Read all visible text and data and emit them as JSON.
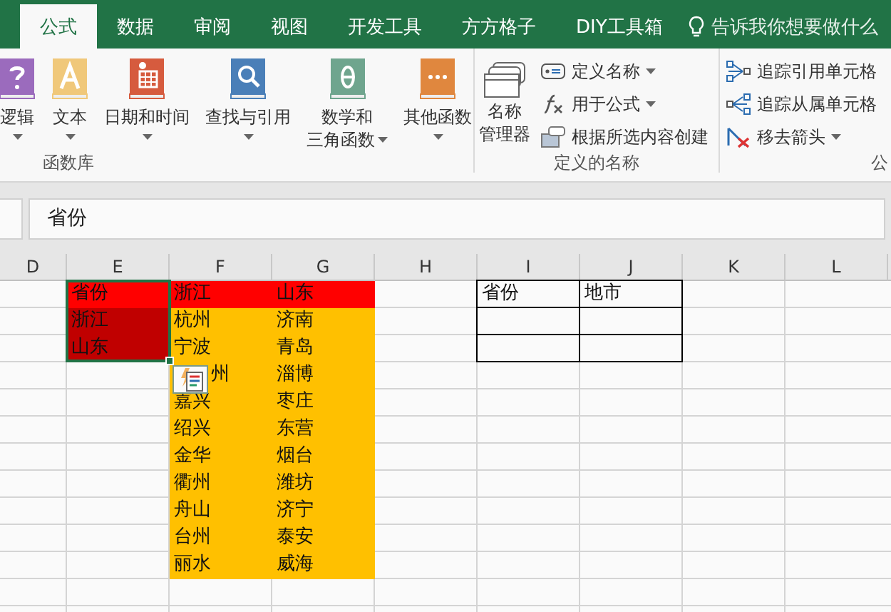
{
  "tabs": [
    {
      "label": "公式",
      "selected": true
    },
    {
      "label": "数据",
      "selected": false
    },
    {
      "label": "审阅",
      "selected": false
    },
    {
      "label": "视图",
      "selected": false
    },
    {
      "label": "开发工具",
      "selected": false
    },
    {
      "label": "方方格子",
      "selected": false
    },
    {
      "label": "DIY工具箱",
      "selected": false
    }
  ],
  "tell_me": "告诉我你想要做什么",
  "function_library": {
    "label": "函数库",
    "buttons": [
      {
        "lines": [
          "逻辑"
        ],
        "dropdown": true
      },
      {
        "lines": [
          "文本"
        ],
        "dropdown": true
      },
      {
        "lines": [
          "日期和时间"
        ],
        "dropdown": true
      },
      {
        "lines": [
          "查找与引用"
        ],
        "dropdown": true
      },
      {
        "lines": [
          "数学和",
          "三角函数"
        ],
        "dropdown": true
      },
      {
        "lines": [
          "其他函数"
        ],
        "dropdown": true
      }
    ]
  },
  "defined_names": {
    "label": "定义的名称",
    "manager": {
      "lines": [
        "名称",
        "管理器"
      ]
    },
    "items": [
      {
        "label": "定义名称",
        "dropdown": true
      },
      {
        "label": "用于公式",
        "dropdown": true
      },
      {
        "label": "根据所选内容创建",
        "dropdown": false
      }
    ]
  },
  "auditing": {
    "label": "公",
    "items": [
      {
        "label": "追踪引用单元格",
        "dropdown": false
      },
      {
        "label": "追踪从属单元格",
        "dropdown": false
      },
      {
        "label": "移去箭头",
        "dropdown": true
      }
    ]
  },
  "formula_bar": {
    "value": "省份"
  },
  "columns": [
    "D",
    "E",
    "F",
    "G",
    "H",
    "I",
    "J",
    "K",
    "L"
  ],
  "rows": [
    {
      "E": {
        "text": "省份",
        "color": "#ff0000",
        "selected": true
      },
      "F": {
        "text": "浙江",
        "color": "#ff0000"
      },
      "G": {
        "text": "山东",
        "color": "#ff0000"
      },
      "I": {
        "text": "省份",
        "bordered": true
      },
      "J": {
        "text": "地市",
        "bordered": true
      }
    },
    {
      "E": {
        "text": "浙江",
        "color": "#c00000",
        "selected": true
      },
      "F": {
        "text": "杭州",
        "color": "#ffc000"
      },
      "G": {
        "text": "济南",
        "color": "#ffc000"
      },
      "I": {
        "bordered": true
      },
      "J": {
        "bordered": true
      }
    },
    {
      "E": {
        "text": "山东",
        "color": "#c00000",
        "selected": true
      },
      "F": {
        "text": "宁波",
        "color": "#ffc000"
      },
      "G": {
        "text": "青岛",
        "color": "#ffc000"
      },
      "I": {
        "bordered": true
      },
      "J": {
        "bordered": true
      }
    },
    {
      "F": {
        "text": "州",
        "color": "#ffc000",
        "covered": true
      },
      "G": {
        "text": "淄博",
        "color": "#ffc000"
      }
    },
    {
      "F": {
        "text": "嘉兴",
        "color": "#ffc000"
      },
      "G": {
        "text": "枣庄",
        "color": "#ffc000"
      }
    },
    {
      "F": {
        "text": "绍兴",
        "color": "#ffc000"
      },
      "G": {
        "text": "东营",
        "color": "#ffc000"
      }
    },
    {
      "F": {
        "text": "金华",
        "color": "#ffc000"
      },
      "G": {
        "text": "烟台",
        "color": "#ffc000"
      }
    },
    {
      "F": {
        "text": "衢州",
        "color": "#ffc000"
      },
      "G": {
        "text": "潍坊",
        "color": "#ffc000"
      }
    },
    {
      "F": {
        "text": "舟山",
        "color": "#ffc000"
      },
      "G": {
        "text": "济宁",
        "color": "#ffc000"
      }
    },
    {
      "F": {
        "text": "台州",
        "color": "#ffc000"
      },
      "G": {
        "text": "泰安",
        "color": "#ffc000"
      }
    },
    {
      "F": {
        "text": "丽水",
        "color": "#ffc000"
      },
      "G": {
        "text": "威海",
        "color": "#ffc000"
      }
    }
  ]
}
